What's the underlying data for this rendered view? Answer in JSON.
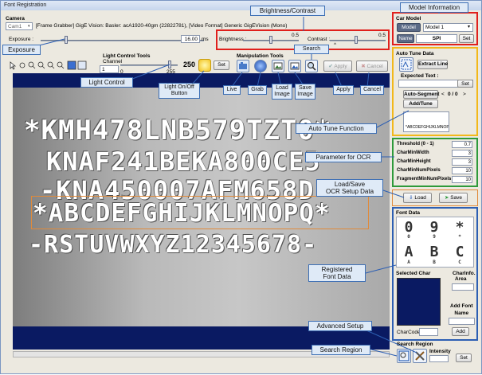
{
  "window": {
    "title": "Font Registration"
  },
  "camera": {
    "group_label": "Camera",
    "select_value": "Cam1",
    "info": "[Frame Grabber] GigE Vision: Basler: acA1920-40gm (22822781),  [Video Format] Generic GigEVision (Mono)",
    "exposure_label": "Exposure :",
    "exposure_value": "16.00",
    "exposure_unit": "ms",
    "brightness_label": "Brightness :",
    "brightness_value": "0.5",
    "contrast_label": "Contrast :",
    "contrast_value": "0.5",
    "contrast_marker": "^"
  },
  "light": {
    "group_label": "Light Control Tools",
    "channel_label": "Channel",
    "channel_value": "1",
    "min": "0",
    "max": "255",
    "value": "250",
    "set_label": "Set"
  },
  "manipulation": {
    "group_label": "Manipulation Tools",
    "apply_label": "Apply",
    "cancel_label": "Cancel"
  },
  "image": {
    "lines": [
      "*KMH478LNB579TZT0*",
      "KNAF241BEKA800CE5",
      "-KNA450007AFM658D",
      "*ABCDEFGHIJKLMNOPQ*",
      "-RSTUVWXYZ12345678-"
    ]
  },
  "car_model": {
    "group_label": "Car Model",
    "model_label": "Model",
    "model_value": "Model 1",
    "name_label": "Name",
    "name_value": "SPI",
    "set_label": "Set"
  },
  "auto_tune": {
    "group_label": "Auto Tune Data",
    "extract_label": "Extract Line",
    "expected_label": "Expected Text :",
    "set_label": "Set",
    "auto_segment_label": "Auto-Segment",
    "nav_prev": "<",
    "nav_count": "0 / 0",
    "nav_next": ">",
    "add_tune_label": "Add/Tune",
    "preview_text": "*ABCDEFGHIJKLMNOP..."
  },
  "ocr_params": {
    "rows": [
      {
        "key": "Threshold (0 - 1)",
        "value": "0.7"
      },
      {
        "key": "CharMinWidth",
        "value": "3"
      },
      {
        "key": "CharMinHeight",
        "value": "3"
      },
      {
        "key": "CharMinNumPixels",
        "value": "10"
      },
      {
        "key": "FragmentMinNumPixels",
        "value": "10"
      }
    ],
    "load_label": "Load",
    "save_label": "Save"
  },
  "font_data": {
    "group_label": "Font Data",
    "glyphs": [
      {
        "glyph": "0",
        "label": "0"
      },
      {
        "glyph": "9",
        "label": "9"
      },
      {
        "glyph": "*",
        "label": "*"
      },
      {
        "glyph": "A",
        "label": "A"
      },
      {
        "glyph": "B",
        "label": "B"
      },
      {
        "glyph": "C",
        "label": "C"
      }
    ],
    "selected_char_label": "Selected Char",
    "char_info_label": "CharInfo.",
    "area_label": "Area",
    "add_font_name_label": "Add Font\nName",
    "char_code_label": "CharCode:",
    "add_label": "Add"
  },
  "search_region": {
    "group_label": "Search Region",
    "intensity_label": "Intensity",
    "set_label": "Set"
  },
  "callouts": {
    "brightness_contrast": "Brightness/Contrast",
    "model_information": "Model Information",
    "exposure": "Exposure",
    "search": "Search",
    "light_control": "Light Control",
    "light_onoff": "Light On/Off\nButton",
    "live": "Live",
    "grab": "Grab",
    "load_image": "Load\nImage",
    "save_image": "Save\nImage",
    "apply": "Apply",
    "cancel": "Cancel",
    "auto_tune_function": "Auto Tune Function",
    "parameter_ocr": "Parameter for OCR",
    "load_save_ocr": "Load/Save\nOCR Setup Data",
    "registered_font": "Registered\nFont Data",
    "advanced_setup": "Advanced Setup",
    "search_region": "Search Region"
  },
  "colors": {
    "frame_red": "#e0201c",
    "frame_yellow": "#f2b81a",
    "frame_green": "#2e9a3a",
    "frame_blue": "#2d5fb3",
    "frame_orange": "#e08a3a",
    "image_bg": "#0a1a62"
  }
}
